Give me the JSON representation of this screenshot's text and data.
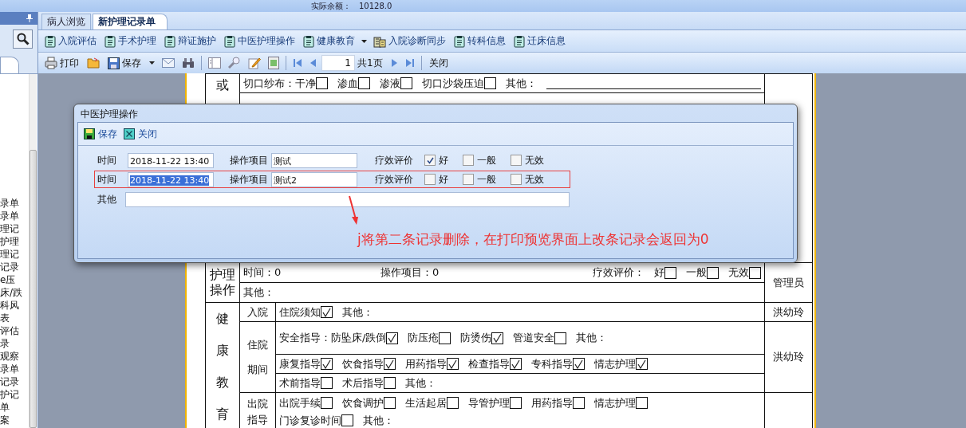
{
  "header": {
    "balance_label": "实际余额：",
    "balance_value": "10128.0"
  },
  "left_panel": {
    "items": [
      "录单",
      "录单",
      "理记",
      "护理",
      "理记",
      "记录",
      "e压",
      "床/跌",
      "科风",
      "表",
      "评估",
      "录",
      "观察",
      "录单",
      "记录",
      "护记",
      "单",
      "案"
    ]
  },
  "tabs": [
    {
      "label": "病人浏览",
      "selected": false
    },
    {
      "label": "新护理记录单",
      "selected": true
    }
  ],
  "toolbar": [
    {
      "label": "入院评估",
      "kind": "form"
    },
    {
      "label": "手术护理",
      "kind": "form"
    },
    {
      "label": "辩证施护",
      "kind": "form"
    },
    {
      "label": "中医护理操作",
      "kind": "form"
    },
    {
      "label": "健康教育",
      "kind": "form",
      "has_menu": true
    },
    {
      "label": "入院诊断同步",
      "kind": "sync"
    },
    {
      "label": "转科信息",
      "kind": "form"
    },
    {
      "label": "迁床信息",
      "kind": "form"
    }
  ],
  "print_toolbar": {
    "print": "打印",
    "save": "保存",
    "page": "1",
    "page_count": "共1页",
    "close": "关闭"
  },
  "document": {
    "upper": {
      "label": "或",
      "rows": [
        [
          {
            "kind": "check",
            "label": "切口纱布：干净",
            "checked": false
          },
          {
            "kind": "check",
            "label": "渗血",
            "checked": false
          },
          {
            "kind": "check",
            "label": "渗液",
            "checked": false
          },
          {
            "kind": "check",
            "label": "切口沙袋压迫",
            "checked": false
          },
          {
            "kind": "text",
            "label": "其他："
          },
          {
            "kind": "blank"
          }
        ]
      ]
    },
    "operation": {
      "label": "护理操作",
      "time": "时间：0",
      "item": "操作项目：0",
      "eval_label": "疗效评价：",
      "options": [
        {
          "label": "好",
          "checked": false
        },
        {
          "label": "一般",
          "checked": false
        },
        {
          "label": "无效",
          "checked": false
        }
      ],
      "other": "其他：",
      "signer": "管理员"
    },
    "education": {
      "label": "健康教育",
      "groups": [
        {
          "label": "入院",
          "signer": "洪幼玲",
          "rows": [
            {
              "lines": [
                [
                  {
                    "kind": "check",
                    "label": "住院须知",
                    "checked": true
                  },
                  {
                    "kind": "text",
                    "label": "其他："
                  }
                ]
              ]
            }
          ]
        },
        {
          "label": "住院期间",
          "signer": "洪幼玲",
          "rows": [
            {
              "lines": [
                [
                  {
                    "kind": "check",
                    "label": "安全指导：防坠床/跌倒",
                    "checked": true
                  },
                  {
                    "kind": "check",
                    "label": "防压疮",
                    "checked": false
                  },
                  {
                    "kind": "check",
                    "label": "防烫伤",
                    "checked": true
                  },
                  {
                    "kind": "check",
                    "label": "管道安全",
                    "checked": false
                  },
                  {
                    "kind": "text",
                    "label": "其他："
                  }
                ]
              ]
            },
            {
              "lines": [
                [
                  {
                    "kind": "check",
                    "label": "康复指导",
                    "checked": true
                  },
                  {
                    "kind": "check",
                    "label": "饮食指导",
                    "checked": true
                  },
                  {
                    "kind": "check",
                    "label": "用药指导",
                    "checked": true
                  },
                  {
                    "kind": "check",
                    "label": "检查指导",
                    "checked": true
                  },
                  {
                    "kind": "check",
                    "label": "专科指导",
                    "checked": true
                  },
                  {
                    "kind": "check",
                    "label": "情志护理",
                    "checked": true
                  }
                ]
              ]
            },
            {
              "lines": [
                [
                  {
                    "kind": "check",
                    "label": "术前指导",
                    "checked": false
                  },
                  {
                    "kind": "check",
                    "label": "术后指导",
                    "checked": false
                  },
                  {
                    "kind": "text",
                    "label": "其他："
                  }
                ]
              ]
            }
          ]
        },
        {
          "label": "出院指导",
          "rows": [
            {
              "lines": [
                [
                  {
                    "kind": "check",
                    "label": "出院手续",
                    "checked": false
                  },
                  {
                    "kind": "check",
                    "label": "饮食调护",
                    "checked": false
                  },
                  {
                    "kind": "check",
                    "label": "生活起居",
                    "checked": false
                  },
                  {
                    "kind": "check",
                    "label": "导管护理",
                    "checked": false
                  },
                  {
                    "kind": "check",
                    "label": "用药指导",
                    "checked": false
                  },
                  {
                    "kind": "check",
                    "label": "情志护理",
                    "checked": false
                  }
                ],
                [
                  {
                    "kind": "check",
                    "label": "门诊复诊时间",
                    "checked": false
                  },
                  {
                    "kind": "text",
                    "label": "其他："
                  }
                ]
              ]
            }
          ]
        }
      ]
    }
  },
  "dialog": {
    "title": "中医护理操作",
    "save": "保存",
    "close": "关闭",
    "rows": [
      {
        "time_label": "时间",
        "time": "2018-11-22 13:40",
        "time_selected": false,
        "item_label": "操作项目",
        "item": "测试",
        "eval_label": "疗效评价",
        "highlighted": false,
        "options": [
          {
            "label": "好",
            "checked": true
          },
          {
            "label": "一般",
            "checked": false
          },
          {
            "label": "无效",
            "checked": false
          }
        ]
      },
      {
        "time_label": "时间",
        "time": "2018-11-22 13:40",
        "time_selected": true,
        "item_label": "操作项目",
        "item": "测试2",
        "eval_label": "疗效评价",
        "highlighted": true,
        "options": [
          {
            "label": "好",
            "checked": false
          },
          {
            "label": "一般",
            "checked": false
          },
          {
            "label": "无效",
            "checked": false
          }
        ]
      }
    ],
    "other_label": "其他"
  },
  "annotation": {
    "text": "j将第二条记录删除，在打印预览界面上改条记录会返回为0"
  }
}
